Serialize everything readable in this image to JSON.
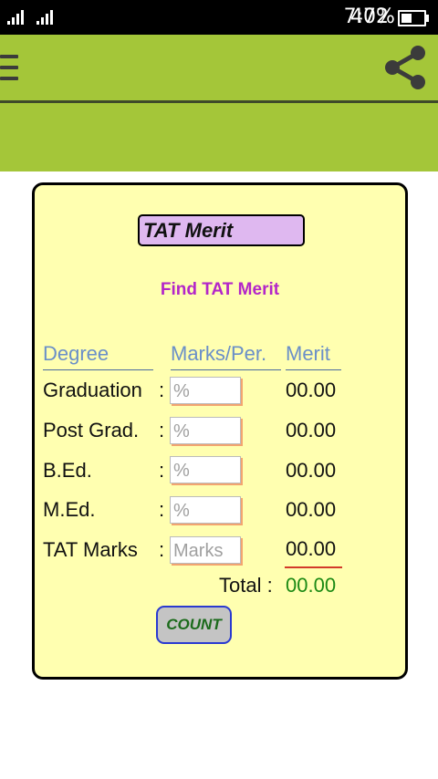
{
  "status_bar": {
    "time": "7:02",
    "battery": "47%",
    "battery_level": 0.47
  },
  "app_bar": {
    "menu_icon": "hamburger-menu-icon",
    "share_icon": "share-icon"
  },
  "form": {
    "title_value": "TAT Merit",
    "subtitle": "Find TAT Merit",
    "headers": {
      "degree": "Degree",
      "marks": "Marks/Per.",
      "merit": "Merit"
    },
    "rows": [
      {
        "label": "Graduation",
        "colon": ":",
        "placeholder": "%",
        "merit": "00.00"
      },
      {
        "label": "Post Grad.",
        "colon": ":",
        "placeholder": "%",
        "merit": "00.00"
      },
      {
        "label": "B.Ed.",
        "colon": ":",
        "placeholder": "%",
        "merit": "00.00"
      },
      {
        "label": "M.Ed.",
        "colon": ":",
        "placeholder": "%",
        "merit": "00.00"
      },
      {
        "label": "TAT Marks",
        "colon": ":",
        "placeholder": "Marks",
        "merit": "00.00"
      }
    ],
    "total_label": "Total :",
    "total_value": "00.00",
    "count_label": "COUNT"
  },
  "colors": {
    "app_bar": "#a4c639",
    "card_bg": "#ffffb0",
    "title_bg": "#dfb8f0",
    "subtitle": "#b326c9",
    "header_text": "#6a8fc8",
    "total_value": "#1c8a14",
    "count_bg": "#c4c4c4"
  }
}
